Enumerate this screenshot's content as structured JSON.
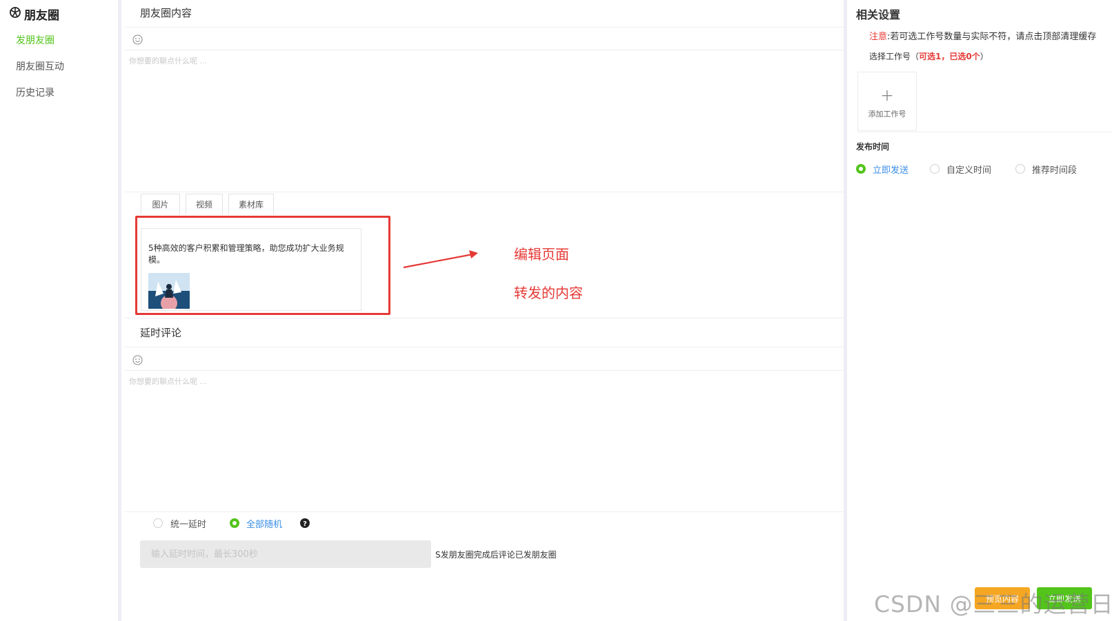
{
  "sidebar": {
    "title": "朋友圈",
    "items": [
      {
        "label": "发朋友圈",
        "active": true
      },
      {
        "label": "朋友圈互动",
        "active": false
      },
      {
        "label": "历史记录",
        "active": false
      }
    ]
  },
  "main": {
    "content_title": "朋友圈内容",
    "content_placeholder": "你想要的聊点什么呢 ...",
    "tabs": [
      "图片",
      "视频",
      "素材库"
    ],
    "card_text": "5种高效的客户积累和管理策略，助您成功扩大业务规模。",
    "annotation_edit": "编辑页面",
    "annotation_forward": "转发的内容",
    "delay_title": "延时评论",
    "delay_placeholder": "你想要的聊点什么呢 ...",
    "delay_mode_options": [
      {
        "label": "统一延时",
        "checked": false
      },
      {
        "label": "全部随机",
        "checked": true
      }
    ],
    "delay_input_placeholder": "输入延时时间，最长300秒",
    "delay_hint": "S发朋友圈完成后评论已发朋友圈"
  },
  "right": {
    "title": "相关设置",
    "note_prefix": "注意",
    "note_text": ":若可选工作号数量与实际不符，请点击顶部清理缓存",
    "choose_label": "选择工作号（",
    "choose_count": "可选1，已选0个",
    "choose_suffix": "）",
    "add_label": "添加工作号",
    "publish_title": "发布时间",
    "publish_options": [
      {
        "label": "立即发送",
        "checked": true
      },
      {
        "label": "自定义时间",
        "checked": false
      },
      {
        "label": "推荐时间段",
        "checked": false
      }
    ]
  },
  "buttons": {
    "preview": "预览内容",
    "publish": "立即发送"
  },
  "watermark": "CSDN @三三的运营日记",
  "colors": {
    "accent_green": "#52c41a",
    "link_blue": "#3a8ee6",
    "annotation_red": "#e53935",
    "orange": "#f5a623"
  }
}
